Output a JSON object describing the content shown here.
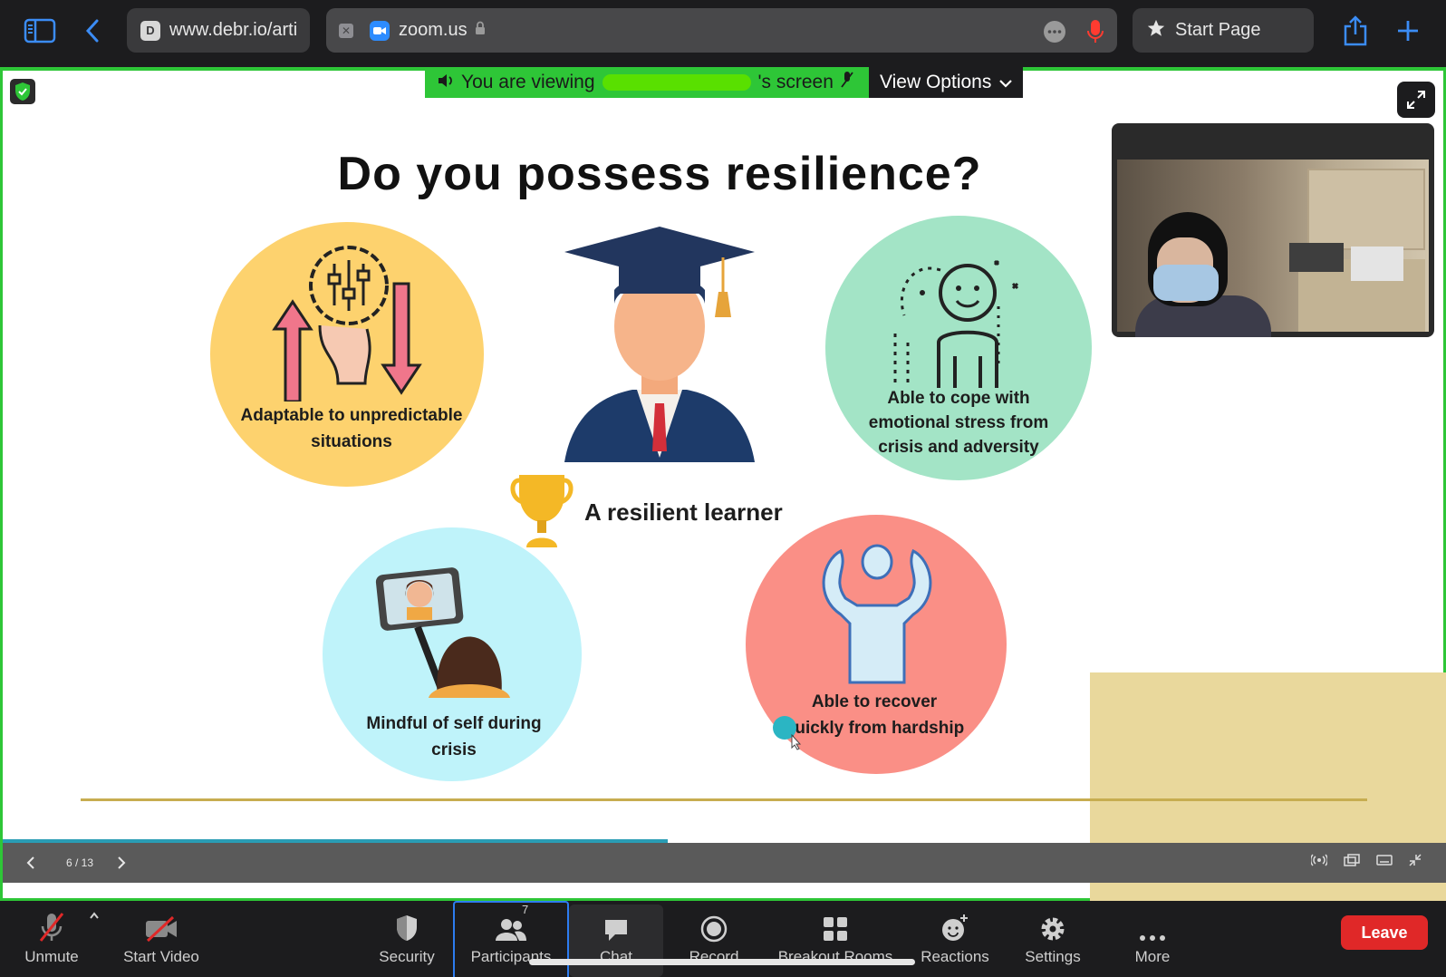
{
  "browser": {
    "tabs": [
      {
        "favicon_letter": "D",
        "label": "www.debr.io/arti"
      },
      {
        "label": "zoom.us"
      },
      {
        "label": "Start Page"
      }
    ]
  },
  "zoom": {
    "banner_prefix": "You are viewing",
    "banner_suffix": "'s screen",
    "view_options": "View Options",
    "slide": {
      "title": "Do you possess resilience?",
      "center_label": "A resilient learner",
      "items": [
        {
          "label": "Adaptable to unpredictable situations"
        },
        {
          "label": "Able to cope with emotional stress from crisis and adversity"
        },
        {
          "label": "Mindful of self during crisis"
        },
        {
          "label": "Able to recover quickly from hardship"
        }
      ],
      "page_indicator": "6 / 13",
      "progress_fraction": 0.46
    },
    "toolbar": {
      "unmute": "Unmute",
      "start_video": "Start Video",
      "security": "Security",
      "participants": "Participants",
      "participants_count": "7",
      "chat": "Chat",
      "record": "Record",
      "breakout_rooms": "Breakout Rooms",
      "reactions": "Reactions",
      "settings": "Settings",
      "more": "More",
      "leave": "Leave"
    }
  },
  "colors": {
    "share_green": "#2ec637",
    "leave_red": "#e02828",
    "participants_blue": "#2d7cf0",
    "circle_yellow": "#fdd26e",
    "circle_green": "#a3e4c6",
    "circle_cyan": "#bff3fa",
    "circle_red": "#fa8f86"
  }
}
